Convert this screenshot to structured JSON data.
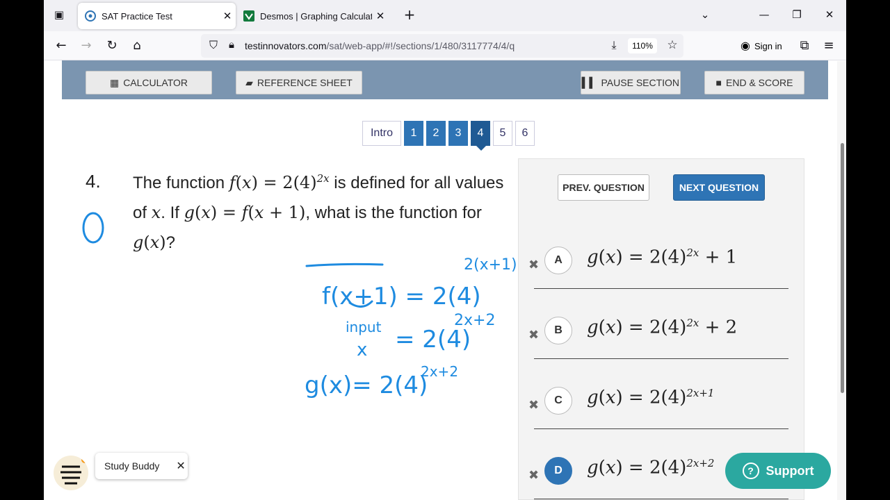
{
  "browser": {
    "tabs": [
      {
        "title": "SAT Practice Test",
        "active": true,
        "icon": "testinnovators-icon"
      },
      {
        "title": "Desmos | Graphing Calculator",
        "active": false,
        "icon": "desmos-icon"
      }
    ],
    "new_tab": "+",
    "url_host": "testinnovators.com",
    "url_path": "/sat/web-app/#!/sections/1/480/3117774/4/q",
    "zoom": "110%",
    "sign_in": "Sign in"
  },
  "toolbar": {
    "calculator": "CALCULATOR",
    "reference": "REFERENCE SHEET",
    "pause": "PAUSE SECTION",
    "end": "END & SCORE"
  },
  "question_nav": {
    "items": [
      "Intro",
      "1",
      "2",
      "3",
      "4",
      "5",
      "6"
    ],
    "current": "4"
  },
  "question": {
    "number": "4."
  },
  "answers": {
    "prev": "PREV. QUESTION",
    "next": "NEXT QUESTION",
    "choices": [
      {
        "letter": "A",
        "selected": false
      },
      {
        "letter": "B",
        "selected": false
      },
      {
        "letter": "C",
        "selected": false
      },
      {
        "letter": "D",
        "selected": true
      }
    ]
  },
  "study_buddy": {
    "label": "Study Buddy"
  },
  "support": {
    "label": "Support"
  },
  "colors": {
    "accent": "#2e74b5",
    "toolbar": "#7b95b0",
    "ink": "#1e8be0",
    "support": "#2ba8a0"
  }
}
